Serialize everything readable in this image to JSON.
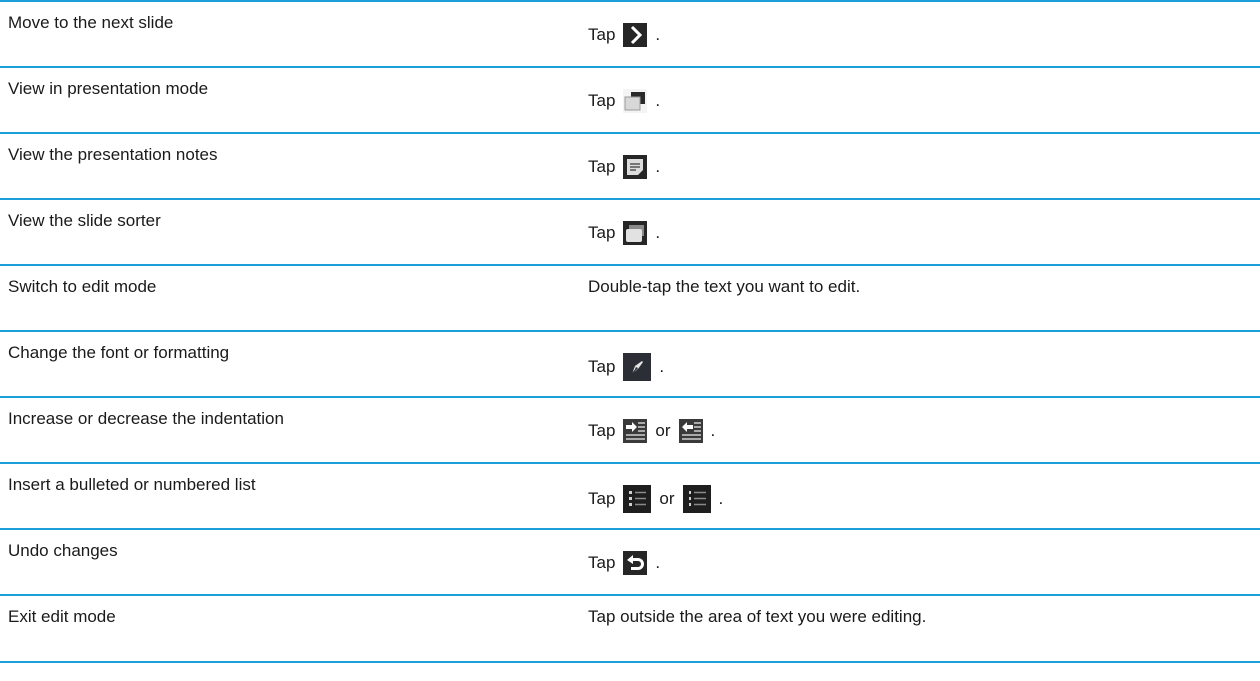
{
  "rows": [
    {
      "task": "Move to the next slide",
      "action_prefix": "Tap",
      "icon": "chevron-right-icon",
      "action_suffix": "."
    },
    {
      "task": "View in presentation mode",
      "action_prefix": "Tap",
      "icon": "presentation-mode-icon",
      "action_suffix": "."
    },
    {
      "task": "View the presentation notes",
      "action_prefix": "Tap",
      "icon": "notes-icon",
      "action_suffix": "."
    },
    {
      "task": "View the slide sorter",
      "action_prefix": "Tap",
      "icon": "slide-sorter-icon",
      "action_suffix": "."
    },
    {
      "task": "Switch to edit mode",
      "action_text": "Double-tap the text you want to edit."
    },
    {
      "task": "Change the font or formatting",
      "action_prefix": "Tap",
      "icon": "pen-icon",
      "action_suffix": "."
    },
    {
      "task": "Increase or decrease the indentation",
      "action_prefix": "Tap",
      "icon": "indent-increase-icon",
      "action_middle": "or",
      "icon2": "indent-decrease-icon",
      "action_suffix": "."
    },
    {
      "task": "Insert a bulleted or numbered list",
      "action_prefix": "Tap",
      "icon": "bulleted-list-icon",
      "action_middle": "or",
      "icon2": "numbered-list-icon",
      "action_suffix": "."
    },
    {
      "task": "Undo changes",
      "action_prefix": "Tap",
      "icon": "undo-icon",
      "action_suffix": "."
    },
    {
      "task": "Exit edit mode",
      "action_text": "Tap outside the area of text you were editing."
    }
  ],
  "colors": {
    "rule": "#1a9fd9",
    "icon_bg": "#262626"
  }
}
